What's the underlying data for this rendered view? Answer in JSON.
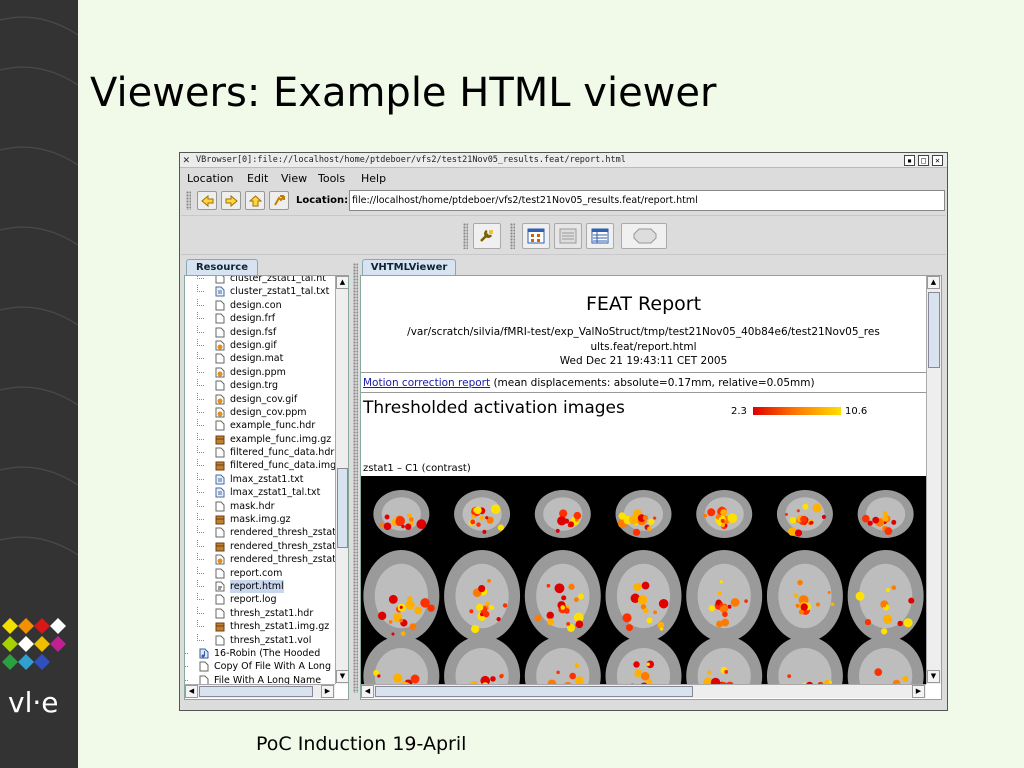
{
  "slide": {
    "title": "Viewers: Example HTML viewer",
    "footer": "PoC Induction 19-April",
    "logo_text": "vl·e",
    "colors": {
      "sidebar": "#333333",
      "background": "#f1f9e8"
    }
  },
  "window": {
    "title": "VBrowser[0]:file://localhost/home/ptdeboer/vfs2/test21Nov05_results.feat/report.html",
    "menu": [
      "Location",
      "Edit",
      "View",
      "Tools",
      "Help"
    ],
    "location_label": "Location:",
    "location_value": "file://localhost/home/ptdeboer/vfs2/test21Nov05_results.feat/report.html"
  },
  "left_panel": {
    "tab": "Resource",
    "items": [
      {
        "label": "cluster_zstat1_tal.ht",
        "icon": "file-icon",
        "level": 1
      },
      {
        "label": "cluster_zstat1_tal.txt",
        "icon": "text-file-icon",
        "level": 1
      },
      {
        "label": "design.con",
        "icon": "file-icon",
        "level": 1
      },
      {
        "label": "design.frf",
        "icon": "file-icon",
        "level": 1
      },
      {
        "label": "design.fsf",
        "icon": "file-icon",
        "level": 1
      },
      {
        "label": "design.gif",
        "icon": "image-file-icon",
        "level": 1
      },
      {
        "label": "design.mat",
        "icon": "file-icon",
        "level": 1
      },
      {
        "label": "design.ppm",
        "icon": "image-file-icon",
        "level": 1
      },
      {
        "label": "design.trg",
        "icon": "file-icon",
        "level": 1
      },
      {
        "label": "design_cov.gif",
        "icon": "image-file-icon",
        "level": 1
      },
      {
        "label": "design_cov.ppm",
        "icon": "image-file-icon",
        "level": 1
      },
      {
        "label": "example_func.hdr",
        "icon": "file-icon",
        "level": 1
      },
      {
        "label": "example_func.img.gz",
        "icon": "archive-file-icon",
        "level": 1
      },
      {
        "label": "filtered_func_data.hdr",
        "icon": "file-icon",
        "level": 1
      },
      {
        "label": "filtered_func_data.img",
        "icon": "archive-file-icon",
        "level": 1
      },
      {
        "label": "lmax_zstat1.txt",
        "icon": "text-file-icon",
        "level": 1
      },
      {
        "label": "lmax_zstat1_tal.txt",
        "icon": "text-file-icon",
        "level": 1
      },
      {
        "label": "mask.hdr",
        "icon": "file-icon",
        "level": 1
      },
      {
        "label": "mask.img.gz",
        "icon": "archive-file-icon",
        "level": 1
      },
      {
        "label": "rendered_thresh_zstat",
        "icon": "file-icon",
        "level": 1
      },
      {
        "label": "rendered_thresh_zstat",
        "icon": "archive-file-icon",
        "level": 1
      },
      {
        "label": "rendered_thresh_zstat",
        "icon": "image-file-icon",
        "level": 1
      },
      {
        "label": "report.com",
        "icon": "file-icon",
        "level": 1
      },
      {
        "label": "report.html",
        "icon": "html-file-icon",
        "level": 1,
        "selected": true
      },
      {
        "label": "report.log",
        "icon": "file-icon",
        "level": 1
      },
      {
        "label": "thresh_zstat1.hdr",
        "icon": "file-icon",
        "level": 1
      },
      {
        "label": "thresh_zstat1.img.gz",
        "icon": "archive-file-icon",
        "level": 1
      },
      {
        "label": "thresh_zstat1.vol",
        "icon": "file-icon",
        "level": 1
      },
      {
        "label": "16-Robin (The Hooded",
        "icon": "audio-file-icon",
        "level": 0
      },
      {
        "label": "Copy Of File With A Long",
        "icon": "file-icon",
        "level": 0
      },
      {
        "label": "File With A Long Name",
        "icon": "file-icon",
        "level": 0
      }
    ]
  },
  "right_panel": {
    "tab": "VHTMLViewer",
    "report": {
      "title": "FEAT Report",
      "path_line1": "/var/scratch/silvia/fMRI-test/exp_ValNoStruct/tmp/test21Nov05_40b84e6/test21Nov05_res",
      "path_line2": "ults.feat/report.html",
      "date": "Wed Dec 21 19:43:11 CET 2005",
      "motion_link": "Motion correction report",
      "motion_text": "(mean displacements: absolute=0.17mm, relative=0.05mm)",
      "activation_title": "Thresholded activation images",
      "colorbar_min": "2.3",
      "colorbar_max": "10.6",
      "zstat_label": "zstat1  –  C1 (contrast)"
    }
  }
}
